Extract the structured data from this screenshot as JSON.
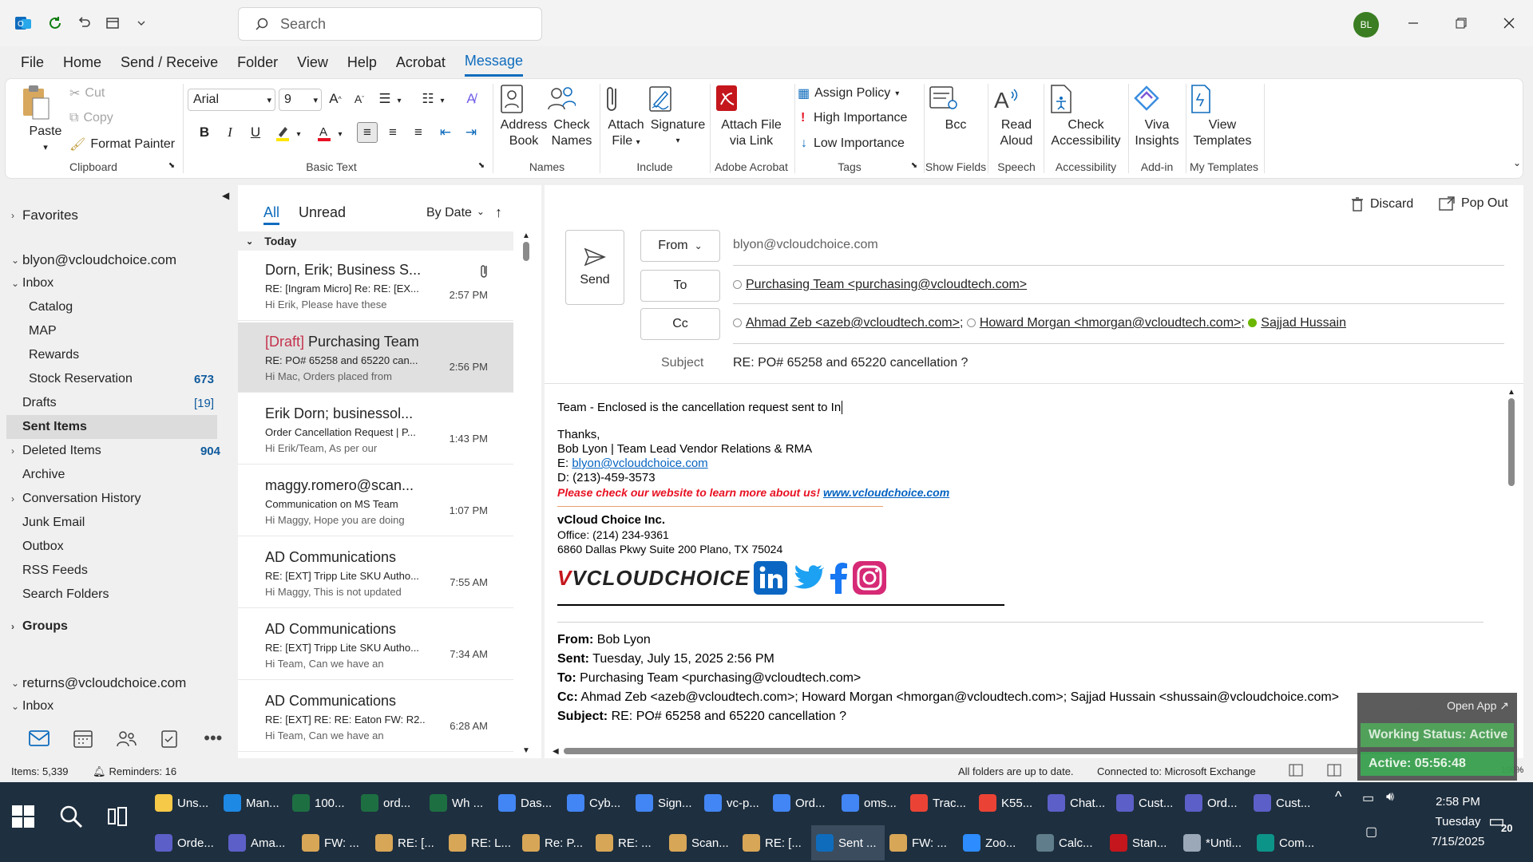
{
  "titlebar": {
    "search_placeholder": "Search",
    "avatar_initials": "BL"
  },
  "menu": [
    "File",
    "Home",
    "Send / Receive",
    "Folder",
    "View",
    "Help",
    "Acrobat",
    "Message"
  ],
  "ribbon": {
    "clipboard": {
      "paste": "Paste",
      "cut": "Cut",
      "copy": "Copy",
      "format_painter": "Format Painter",
      "label": "Clipboard"
    },
    "basic_text": {
      "font": "Arial",
      "size": "9",
      "label": "Basic Text",
      "bold": "B",
      "italic": "I",
      "underline": "U"
    },
    "names": {
      "address_book": [
        "Address",
        "Book"
      ],
      "check_names": [
        "Check",
        "Names"
      ],
      "label": "Names"
    },
    "include": {
      "attach_file": [
        "Attach",
        "File"
      ],
      "signature": "Signature",
      "label": "Include"
    },
    "acrobat": {
      "attach_link": [
        "Attach File",
        "via Link"
      ],
      "label": "Adobe Acrobat"
    },
    "tags": {
      "assign_policy": "Assign Policy",
      "high": "High Importance",
      "low": "Low Importance",
      "label": "Tags"
    },
    "show_fields": {
      "bcc": "Bcc",
      "label": "Show Fields"
    },
    "speech": {
      "read_aloud": [
        "Read",
        "Aloud"
      ],
      "label": "Speech"
    },
    "accessibility": {
      "check": [
        "Check",
        "Accessibility"
      ],
      "label": "Accessibility"
    },
    "addin": {
      "viva": [
        "Viva",
        "Insights"
      ],
      "label": "Add-in"
    },
    "templates": {
      "view": [
        "View",
        "Templates"
      ],
      "label": "My Templates"
    }
  },
  "folders": {
    "favorites": "Favorites",
    "account1": "blyon@vcloudchoice.com",
    "items": [
      {
        "label": "Inbox",
        "count": ""
      },
      {
        "label": "Catalog",
        "count": ""
      },
      {
        "label": "MAP",
        "count": ""
      },
      {
        "label": "Rewards",
        "count": ""
      },
      {
        "label": "Stock Reservation",
        "count": "673"
      },
      {
        "label": "Drafts",
        "count": "[19]"
      },
      {
        "label": "Sent Items",
        "count": ""
      },
      {
        "label": "Deleted Items",
        "count": "904"
      },
      {
        "label": "Archive",
        "count": ""
      },
      {
        "label": "Conversation History",
        "count": ""
      },
      {
        "label": "Junk Email",
        "count": ""
      },
      {
        "label": "Outbox",
        "count": ""
      },
      {
        "label": "RSS Feeds",
        "count": ""
      },
      {
        "label": "Search Folders",
        "count": ""
      }
    ],
    "groups": "Groups",
    "account2": "returns@vcloudchoice.com",
    "inbox2": "Inbox"
  },
  "list": {
    "tab_all": "All",
    "tab_unread": "Unread",
    "sort": "By Date",
    "group": "Today",
    "messages": [
      {
        "draft": "",
        "from": "Dorn, Erik; Business S...",
        "subject": "RE: [Ingram Micro] Re: RE: [EX...",
        "preview": "Hi Erik,  Please have these",
        "time": "2:57 PM"
      },
      {
        "draft": "[Draft]",
        "from": " Purchasing Team",
        "subject": "RE: PO# 65258 and 65220 can...",
        "preview": "Hi Mac,  Orders placed from",
        "time": "2:56 PM"
      },
      {
        "draft": "",
        "from": "Erik Dorn; businessol...",
        "subject": "Order Cancellation Request | P...",
        "preview": "Hi Erik/Team,  As per our",
        "time": "1:43 PM"
      },
      {
        "draft": "",
        "from": "maggy.romero@scan...",
        "subject": "Communication on MS Team",
        "preview": "Hi Maggy,  Hope you are doing",
        "time": "1:07 PM"
      },
      {
        "draft": "",
        "from": "AD Communications",
        "subject": "RE: [EXT] Tripp Lite SKU Autho...",
        "preview": "Hi Maggy,  This is not updated",
        "time": "7:55 AM"
      },
      {
        "draft": "",
        "from": "AD Communications",
        "subject": "RE: [EXT] Tripp Lite SKU Autho...",
        "preview": "Hi Team,  Can we have an",
        "time": "7:34 AM"
      },
      {
        "draft": "",
        "from": "AD Communications",
        "subject": "RE: [EXT] RE: RE: Eaton FW: R2...",
        "preview": "Hi Team,  Can we have an",
        "time": "6:28 AM"
      }
    ]
  },
  "compose": {
    "discard": "Discard",
    "popout": "Pop Out",
    "send": "Send",
    "from_btn": "From",
    "to_btn": "To",
    "cc_btn": "Cc",
    "from_value": "blyon@vcloudchoice.com",
    "to_value": "Purchasing Team <purchasing@vcloudtech.com>",
    "cc1": "Ahmad Zeb <azeb@vcloudtech.com>;",
    "cc2": "Howard Morgan <hmorgan@vcloudtech.com>;",
    "cc3": "Sajjad Hussain",
    "subject_label": "Subject",
    "subject_value": "RE: PO# 65258 and 65220 cancellation ?"
  },
  "body": {
    "line1": "Team -  Enclosed is the cancellation request sent to In",
    "thanks": "Thanks,",
    "sig_name": "Bob Lyon | Team Lead Vendor Relations & RMA",
    "email_prefix": "E: ",
    "email": "blyon@vcloudchoice.com",
    "phone": "D: (213)-459-3573",
    "promo": "Please check our website to learn more about us! ",
    "website": "www.vcloudchoice.com",
    "company": "vCloud Choice Inc.",
    "office": "Office: (214) 234-9361",
    "address": "6860 Dallas Pkwy Suite 200 Plano, TX 75024",
    "logo_text": "VCLOUDCHOICE",
    "q_from_l": "From:",
    "q_from": " Bob Lyon",
    "q_sent_l": "Sent:",
    "q_sent": " Tuesday, July 15, 2025 2:56 PM",
    "q_to_l": "To:",
    "q_to": " Purchasing Team <purchasing@vcloudtech.com>",
    "q_cc_l": "Cc:",
    "q_cc": " Ahmad Zeb <azeb@vcloudtech.com>; Howard Morgan <hmorgan@vcloudtech.com>; Sajjad Hussain <shussain@vcloudchoice.com>",
    "q_subj_l": "Subject:",
    "q_subj": " RE: PO# 65258 and 65220 cancellation ?"
  },
  "status": {
    "items": "Items: 5,339",
    "reminders": "Reminders: 16",
    "uptodate": "All folders are up to date.",
    "connected": "Connected to: Microsoft Exchange",
    "zoom": "100%"
  },
  "widget": {
    "open_app": "Open App",
    "working": "Working Status: Active",
    "active": "Active: 05:56:48"
  },
  "taskbar": {
    "row1": [
      "Uns...",
      "Man...",
      "100...",
      "ord...",
      "Wh ...",
      "Das...",
      "Cyb...",
      "Sign...",
      "vc-p...",
      "Ord...",
      "oms...",
      "Trac...",
      "K55...",
      "Chat...",
      "Cust...",
      "Ord...",
      "Cust..."
    ],
    "row2": [
      "Orde...",
      "Ama...",
      "FW: ...",
      "RE: [...",
      "RE: L...",
      "Re: P...",
      "RE: ...",
      "Scan...",
      "RE: [...",
      "Sent ...",
      "FW: ...",
      "Zoo...",
      "Calc...",
      "Stan...",
      "*Unti...",
      "Com..."
    ],
    "time": "2:58 PM",
    "day": "Tuesday",
    "date": "7/15/2025",
    "notif": "20"
  },
  "colors": {
    "accent": "#0f6cbd",
    "draft": "#c4314b",
    "promo": "#e81123",
    "link": "#0563c1"
  }
}
